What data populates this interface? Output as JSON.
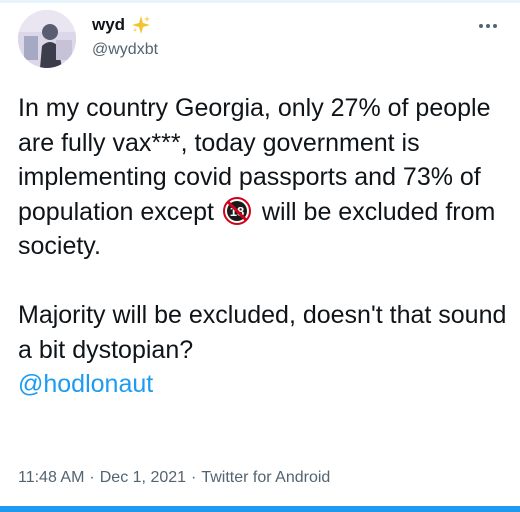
{
  "author": {
    "display_name": "wyd",
    "handle": "@wydxbt"
  },
  "tweet": {
    "paragraph1_part1": "In my country Georgia, only 27% of people are fully vax***, today government is implementing covid passports and 73% of population except",
    "paragraph1_part2": "will be excluded from society.",
    "paragraph2": "Majority will be excluded, doesn't that sound a bit dystopian?",
    "mention": "@hodlonaut"
  },
  "meta": {
    "time": "11:48 AM",
    "separator": "·",
    "date": "Dec 1, 2021",
    "source": "Twitter for Android"
  },
  "icons": {
    "sparkles": "sparkles-icon",
    "no_under_18": "no-under-18-icon",
    "more": "more-icon"
  },
  "colors": {
    "text": "#0f1419",
    "secondary": "#536471",
    "accent": "#1d9bf0",
    "sparkle": "#f4c430",
    "prohibited": "#d0021b"
  }
}
